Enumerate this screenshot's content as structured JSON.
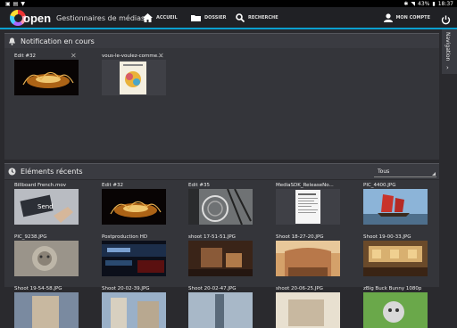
{
  "status": {
    "battery": "43%",
    "time": "18:37"
  },
  "app": {
    "logo_text": "open",
    "title": "Gestionnaires de médias"
  },
  "nav": {
    "home": "ACCUEIL",
    "folder": "DOSSIER",
    "search": "RECHERCHE",
    "account": "MON COMPTE"
  },
  "notifications": {
    "title": "Notification en cours",
    "items": [
      {
        "label": "Edit #32",
        "thumb": "dark-fireworks"
      },
      {
        "label": "vous-le-voulez-comme...",
        "thumb": "poster"
      }
    ]
  },
  "recent": {
    "title": "Eléments récents",
    "filter": "Tous",
    "items": [
      {
        "label": "Billboard French.mov",
        "thumb": "send-key"
      },
      {
        "label": "Edit #32",
        "thumb": "dark-fireworks"
      },
      {
        "label": "Edit #35",
        "thumb": "bw-mechanism"
      },
      {
        "label": "MediaSDK_ReleaseNo...",
        "thumb": "document"
      },
      {
        "label": "PIC_4400.JPG",
        "thumb": "junk-boat"
      },
      {
        "label": "PIC_9238.JPG",
        "thumb": "lion-statue"
      },
      {
        "label": "Postproduction HD",
        "thumb": "ticker"
      },
      {
        "label": "shoot 17-51-51.JPG",
        "thumb": "room"
      },
      {
        "label": "Shoot 18-27-20.JPG",
        "thumb": "hotel"
      },
      {
        "label": "Shoot 19-00-33.JPG",
        "thumb": "lobby"
      },
      {
        "label": "Shoot 19-54-58.JPG",
        "thumb": "building"
      },
      {
        "label": "Shoot 20-02-39.JPG",
        "thumb": "street"
      },
      {
        "label": "Shoot 20-02-47.JPG",
        "thumb": "tower"
      },
      {
        "label": "shoot 20-06-25.JPG",
        "thumb": "bright"
      },
      {
        "label": "zBig Buck Bunny 1080p",
        "thumb": "bunny"
      }
    ]
  },
  "side_panel": {
    "label": "Navigation"
  },
  "colors": {
    "accent": "#0aa0d0",
    "header_bg": "#202125",
    "section_bg": "#34353a"
  }
}
